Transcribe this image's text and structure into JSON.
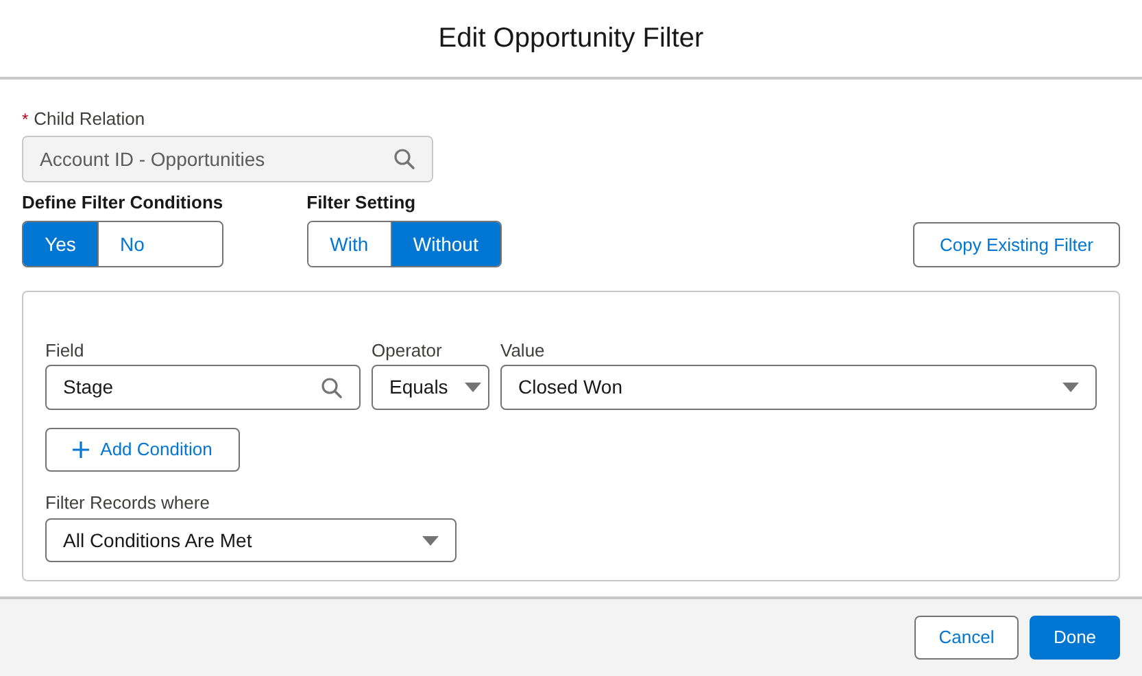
{
  "title": "Edit Opportunity Filter",
  "child_relation": {
    "label": "Child Relation",
    "required_mark": "*",
    "value": "Account ID - Opportunities"
  },
  "define_filter_conditions": {
    "label": "Define Filter Conditions",
    "options": [
      {
        "label": "Yes",
        "selected": true
      },
      {
        "label": "No",
        "selected": false
      }
    ]
  },
  "filter_setting": {
    "label": "Filter Setting",
    "options": [
      {
        "label": "With",
        "selected": false
      },
      {
        "label": "Without",
        "selected": true
      }
    ]
  },
  "copy_button": "Copy Existing Filter",
  "condition": {
    "field_label": "Field",
    "field_value": "Stage",
    "operator_label": "Operator",
    "operator_value": "Equals",
    "value_label": "Value",
    "value_value": "Closed Won"
  },
  "add_condition": "Add Condition",
  "filter_records": {
    "label": "Filter Records where",
    "value": "All Conditions Are Met"
  },
  "footer_buttons": [
    {
      "label": "Cancel",
      "kind": "neutral"
    },
    {
      "label": "Done",
      "kind": "brand"
    }
  ]
}
